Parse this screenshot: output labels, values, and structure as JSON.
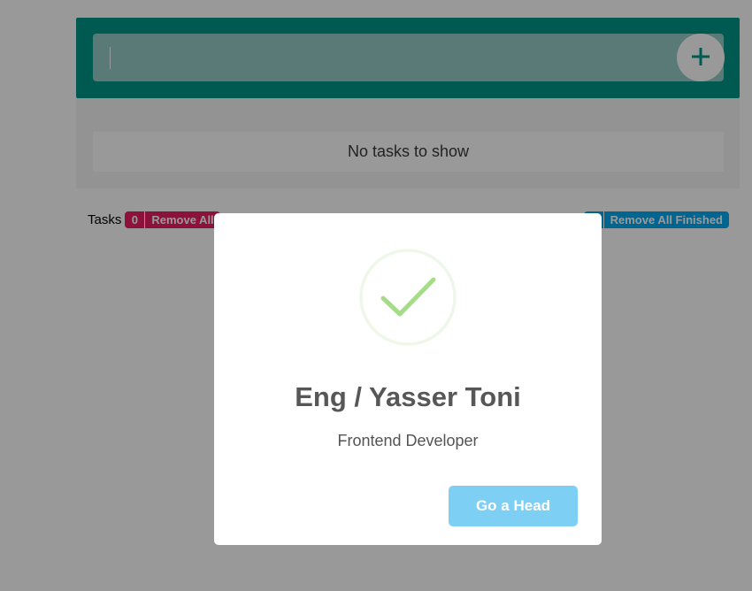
{
  "app": {
    "input": {
      "value": "",
      "placeholder": ""
    },
    "add_button": {
      "icon": "plus-icon"
    },
    "empty_message": "No tasks to show",
    "stats": {
      "tasks_label": "Tasks",
      "tasks_count": "0",
      "remove_all_label": "Remove All",
      "finished_count": "",
      "remove_finished_label": "Remove All Finished"
    },
    "colors": {
      "primary": "#009688",
      "danger": "#e91e63",
      "info": "#03a9f4"
    }
  },
  "modal": {
    "icon": "success-check-icon",
    "title": "Eng / Yasser Toni",
    "text": "Frontend Developer",
    "confirm_label": "Go a Head",
    "colors": {
      "check": "#a5dc86",
      "confirm_bg": "#7ecff4"
    }
  }
}
